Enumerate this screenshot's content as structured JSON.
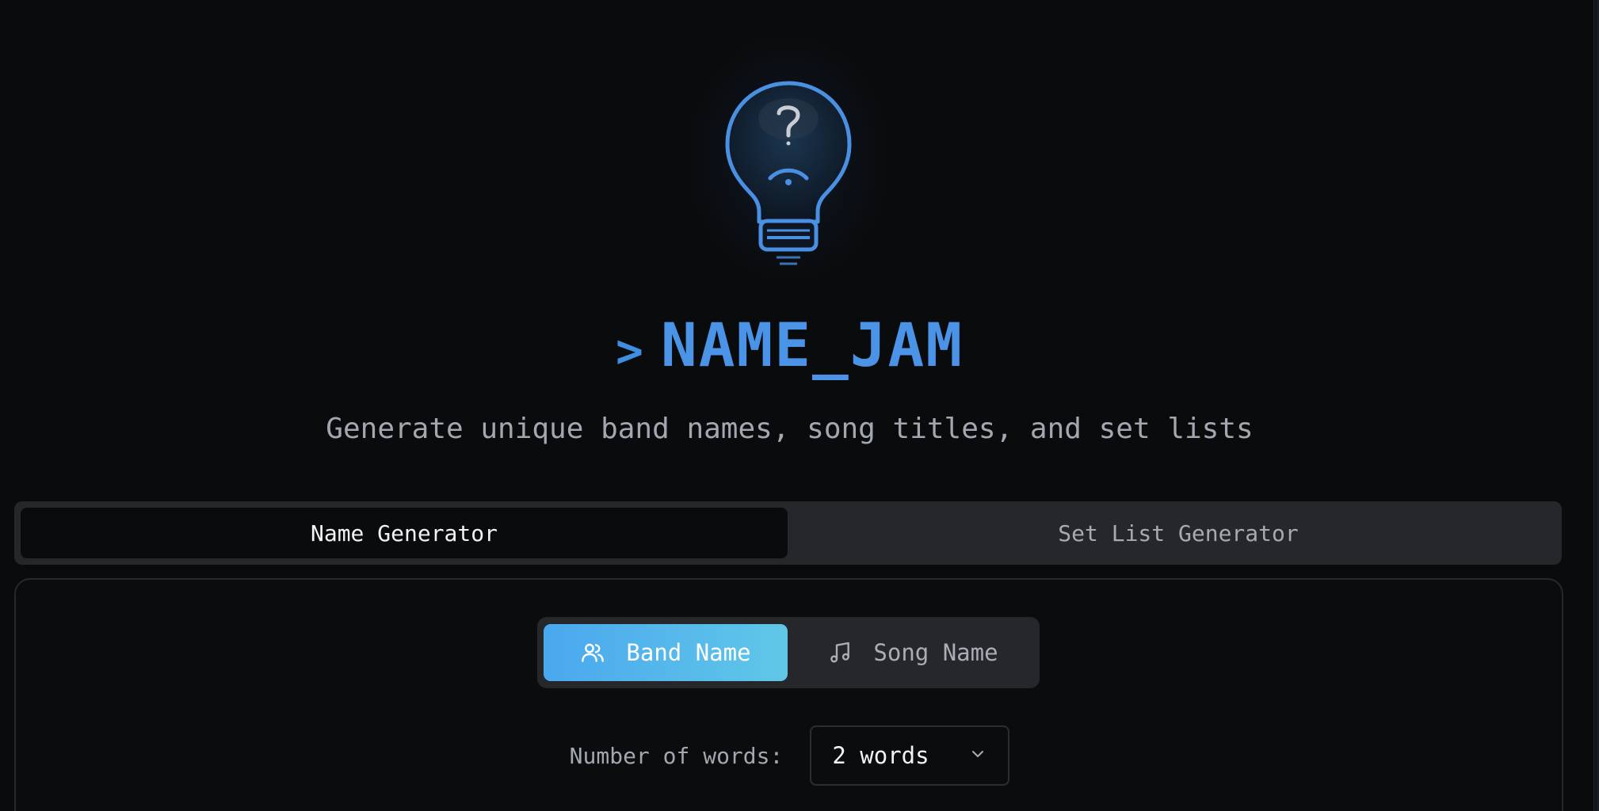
{
  "header": {
    "prompt_symbol": ">",
    "title": "NAME_JAM",
    "subtitle": "Generate unique band names, song titles, and set lists",
    "logo_icon": "lightbulb-question-icon"
  },
  "tabs": [
    {
      "label": "Name Generator",
      "active": true
    },
    {
      "label": "Set List Generator",
      "active": false
    }
  ],
  "name_type": {
    "options": [
      {
        "label": "Band Name",
        "icon": "users-icon",
        "active": true
      },
      {
        "label": "Song Name",
        "icon": "music-note-icon",
        "active": false
      }
    ]
  },
  "words": {
    "label": "Number of words:",
    "selected": "2 words",
    "icon": "chevron-down-icon"
  },
  "colors": {
    "background": "#0a0b0d",
    "accent": "#4a93e6",
    "active_gradient_start": "#4aa8ee",
    "active_gradient_end": "#60c7e8"
  }
}
